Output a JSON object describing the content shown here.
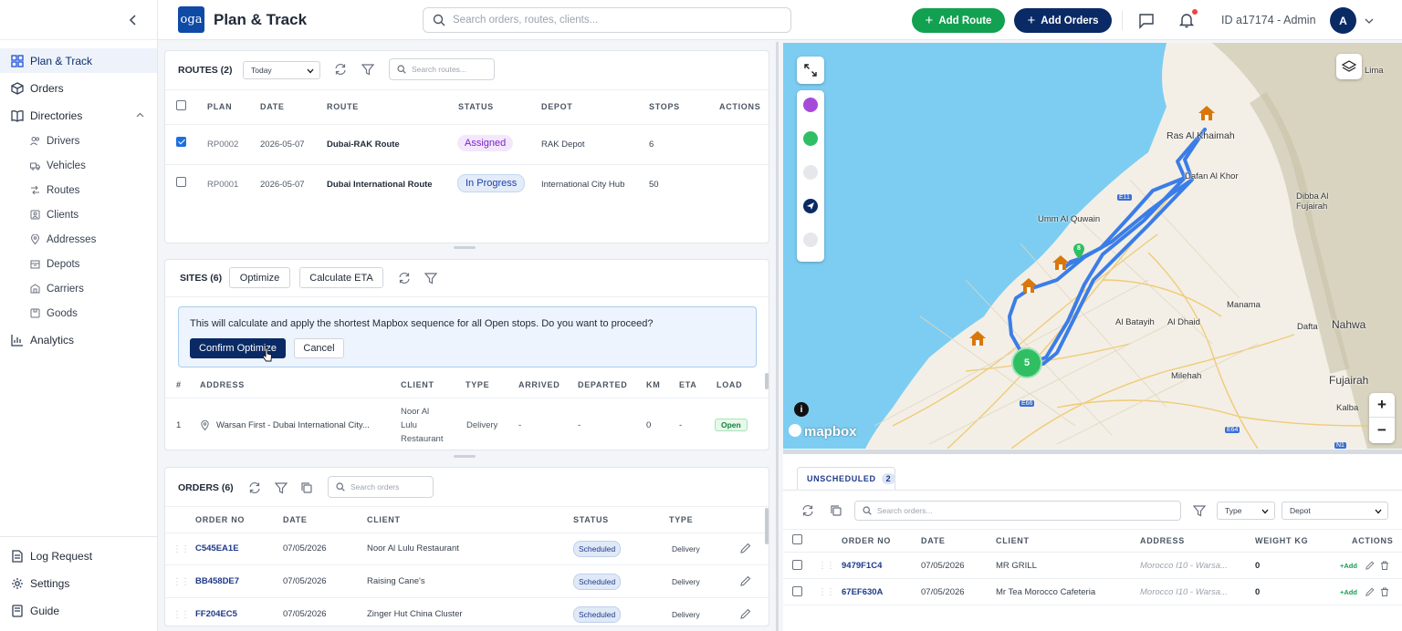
{
  "app": {
    "logo": "oga",
    "title": "Plan & Track",
    "search_placeholder": "Search orders, routes, clients...",
    "add_route": "Add Route",
    "add_orders": "Add Orders",
    "user": "ID a17174 - Admin",
    "avatar": "A"
  },
  "sidebar": {
    "items": [
      {
        "label": "Plan & Track",
        "icon": "grid-icon"
      },
      {
        "label": "Orders",
        "icon": "box-icon"
      },
      {
        "label": "Directories",
        "icon": "book-icon"
      }
    ],
    "sub": [
      {
        "label": "Drivers",
        "icon": "users-icon"
      },
      {
        "label": "Vehicles",
        "icon": "truck-icon"
      },
      {
        "label": "Routes",
        "icon": "route-icon"
      },
      {
        "label": "Clients",
        "icon": "client-icon"
      },
      {
        "label": "Addresses",
        "icon": "pin-icon"
      },
      {
        "label": "Depots",
        "icon": "depot-icon"
      },
      {
        "label": "Carriers",
        "icon": "carrier-icon"
      },
      {
        "label": "Goods",
        "icon": "goods-icon"
      }
    ],
    "analytics": "Analytics",
    "bottom": [
      {
        "label": "Log Request"
      },
      {
        "label": "Settings"
      },
      {
        "label": "Guide"
      }
    ]
  },
  "routes": {
    "title": "ROUTES (2)",
    "filter": "Today",
    "search_placeholder": "Search routes...",
    "headers": [
      "PLAN",
      "DATE",
      "ROUTE",
      "STATUS",
      "DEPOT",
      "STOPS",
      "ACTIONS"
    ],
    "rows": [
      {
        "plan": "RP0002",
        "date": "2026-05-07",
        "route": "Dubai-RAK Route",
        "status": "Assigned",
        "depot": "RAK Depot",
        "stops": "6",
        "checked": true
      },
      {
        "plan": "RP0001",
        "date": "2026-05-07",
        "route": "Dubai International Route",
        "status": "In Progress",
        "depot": "International City Hub",
        "stops": "50",
        "checked": false
      }
    ]
  },
  "sites": {
    "title": "SITES (6)",
    "optimize": "Optimize",
    "calc_eta": "Calculate ETA",
    "confirm_text": "This will calculate and apply the shortest Mapbox sequence for all Open stops. Do you want to proceed?",
    "confirm_btn": "Confirm Optimize",
    "cancel_btn": "Cancel",
    "headers": [
      "#",
      "ADDRESS",
      "CLIENT",
      "TYPE",
      "ARRIVED",
      "DEPARTED",
      "KM",
      "ETA",
      "LOAD"
    ],
    "rows": [
      {
        "n": "1",
        "address": "Warsan First - Dubai International City...",
        "client_1": "Noor Al",
        "client_2": "Lulu",
        "client_3": "Restaurant",
        "type": "Delivery",
        "arrived": "-",
        "departed": "-",
        "km": "0",
        "eta": "-",
        "load": "Open"
      }
    ]
  },
  "orders": {
    "title": "ORDERS (6)",
    "search_placeholder": "Search orders",
    "headers": [
      "ORDER NO",
      "DATE",
      "CLIENT",
      "STATUS",
      "TYPE"
    ],
    "rows": [
      {
        "no": "C545EA1E",
        "date": "07/05/2026",
        "client": "Noor Al Lulu Restaurant",
        "status": "Scheduled",
        "type": "Delivery"
      },
      {
        "no": "BB458DE7",
        "date": "07/05/2026",
        "client": "Raising Cane's",
        "status": "Scheduled",
        "type": "Delivery"
      },
      {
        "no": "FF204EC5",
        "date": "07/05/2026",
        "client": "Zinger Hut China Cluster",
        "status": "Scheduled",
        "type": "Delivery"
      }
    ]
  },
  "map": {
    "labels": [
      "Ras Al Khaimah",
      "Dafan Al Khor",
      "Umm Al Quwain",
      "Dibba Al Fujairah",
      "Manama",
      "Al Batayih",
      "Al Dhaid",
      "Dafta",
      "Nahwa",
      "Milehah",
      "Fujairah",
      "Kalba",
      "Lima"
    ],
    "road_labels": [
      "E11",
      "E66",
      "E64",
      "N1"
    ],
    "cluster": "5",
    "stop_badge": "8",
    "attribution": "mapbox",
    "info": "i",
    "zoom_in": "+",
    "zoom_out": "−"
  },
  "unscheduled": {
    "tab": "UNSCHEDULED",
    "count": "2",
    "search_placeholder": "Search orders...",
    "type_filter": "Type",
    "depot_filter": "Depot",
    "headers": [
      "ORDER NO",
      "DATE",
      "CLIENT",
      "ADDRESS",
      "WEIGHT KG",
      "ACTIONS"
    ],
    "add_label": "+Add",
    "rows": [
      {
        "no": "9479F1C4",
        "date": "07/05/2026",
        "client": "MR GRILL",
        "address": "Morocco I10 - Warsa...",
        "weight": "0"
      },
      {
        "no": "67EF630A",
        "date": "07/05/2026",
        "client": "Mr Tea Morocco Cafeteria",
        "address": "Morocco I10 - Warsa...",
        "weight": "0"
      }
    ]
  },
  "colors": {
    "brand": "#0a2a66",
    "green": "#12a150",
    "water": "#7ccdf1",
    "land": "#f3efe6",
    "route": "#3b7de8",
    "house": "#d9770b"
  }
}
